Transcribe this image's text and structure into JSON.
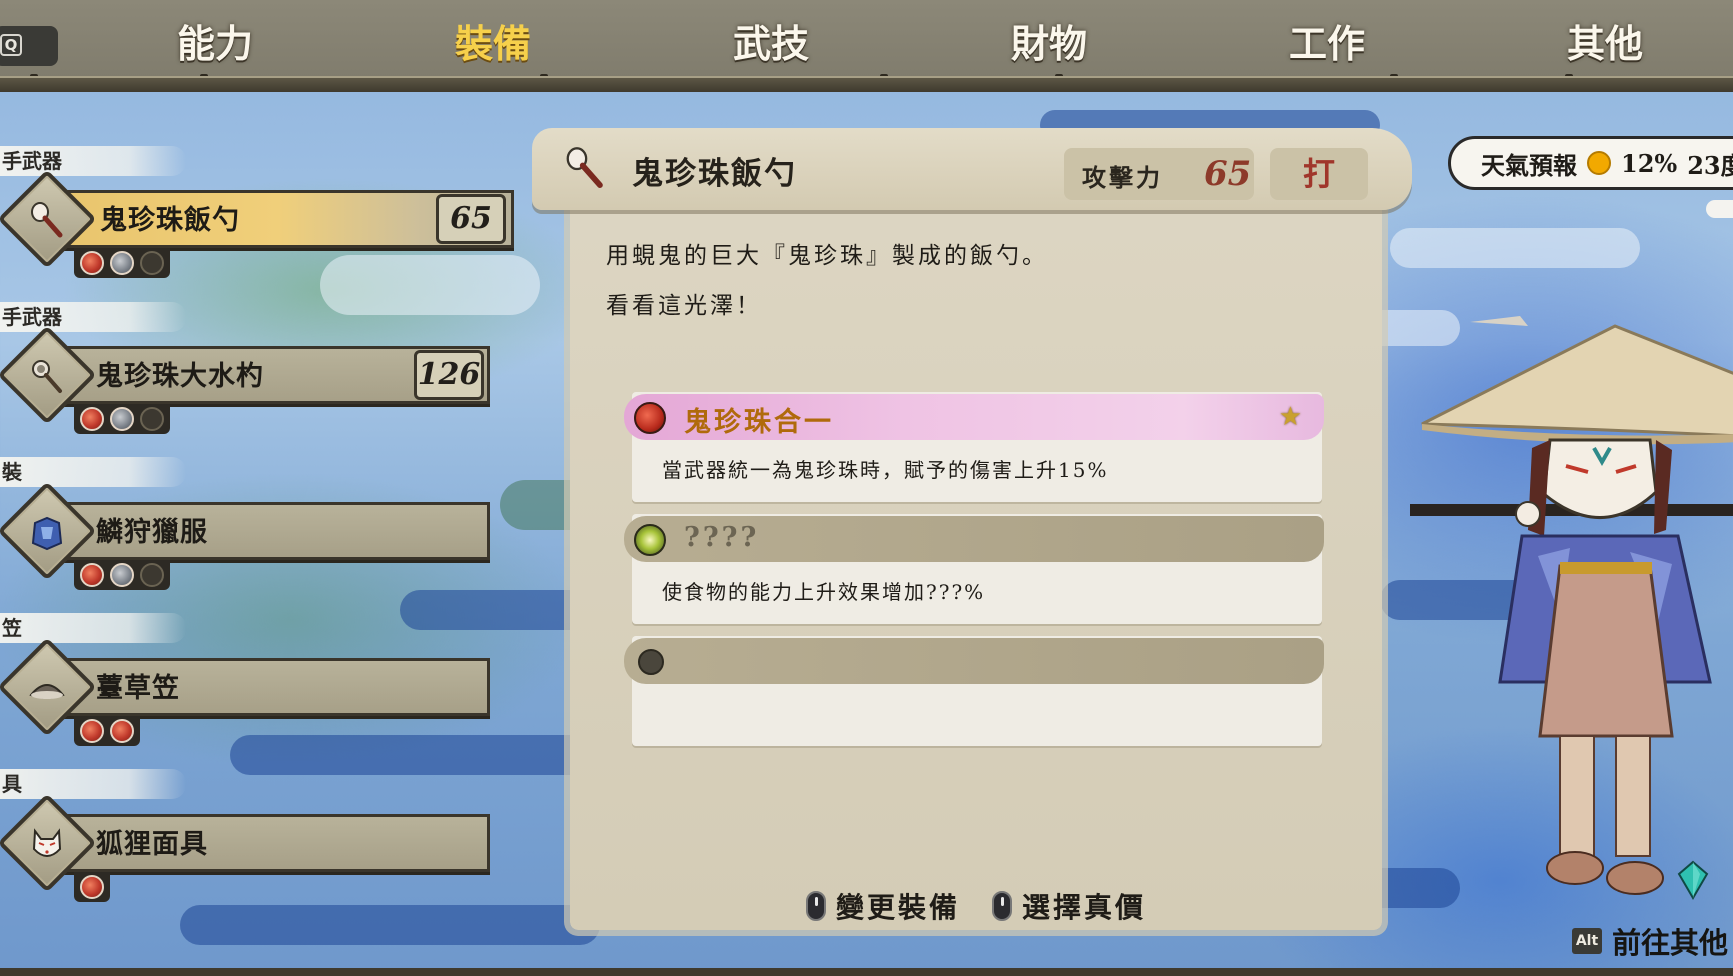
{
  "tabs": [
    {
      "label": "能力",
      "active": false
    },
    {
      "label": "裝備",
      "active": true
    },
    {
      "label": "武技",
      "active": false
    },
    {
      "label": "財物",
      "active": false
    },
    {
      "label": "工作",
      "active": false
    },
    {
      "label": "其他",
      "active": false
    }
  ],
  "key_hint": "Q",
  "equipment": [
    {
      "slot": "手武器",
      "name": "鬼珍珠飯勺",
      "value": "65",
      "icon": "ladle-icon",
      "sockets": [
        "red",
        "grey",
        "empty"
      ],
      "selected": true
    },
    {
      "slot": "手武器",
      "name": "鬼珍珠大水杓",
      "value": "126",
      "icon": "water-dipper-icon",
      "sockets": [
        "red",
        "grey",
        "empty"
      ],
      "selected": false
    },
    {
      "slot": "裝",
      "name": "鱗狩獵服",
      "value": "",
      "icon": "armor-icon",
      "sockets": [
        "red",
        "grey",
        "empty"
      ],
      "selected": false
    },
    {
      "slot": "笠",
      "name": "薹草笠",
      "value": "",
      "icon": "straw-hat-icon",
      "sockets": [
        "red",
        "red"
      ],
      "selected": false
    },
    {
      "slot": "具",
      "name": "狐狸面具",
      "value": "",
      "icon": "fox-mask-icon",
      "sockets": [
        "red"
      ],
      "selected": false
    }
  ],
  "detail": {
    "title": "鬼珍珠飯勺",
    "attack_label": "攻擊力",
    "attack_value": "65",
    "attack_type": "打",
    "description_lines": [
      "用蜆鬼的巨大『鬼珍珠』製成的飯勺。",
      "看看這光澤！"
    ],
    "skills": [
      {
        "name": "鬼珍珠合一",
        "description": "當武器統一為鬼珍珠時，賦予的傷害上升15%",
        "style": "pink",
        "icon": "red-orb-icon",
        "favorite": true
      },
      {
        "name": "????",
        "description": "使食物的能力上升效果增加???%",
        "style": "dim",
        "icon": "sparkle-orb-icon",
        "favorite": false
      },
      {
        "name": "",
        "description": "",
        "style": "dim",
        "icon": "empty-socket-icon",
        "favorite": false
      }
    ]
  },
  "footer": {
    "change_equipment": "變更裝備",
    "select_true_price": "選擇真價"
  },
  "weather": {
    "label": "天氣預報",
    "chance": "12%",
    "extra": "23度"
  },
  "alt_hint": {
    "key": "Alt",
    "label": "前往其他"
  },
  "colors": {
    "active_tab": "#f6d04b",
    "attack_value": "#8d3a2a",
    "skill_highlight": "#e4a7d6"
  }
}
